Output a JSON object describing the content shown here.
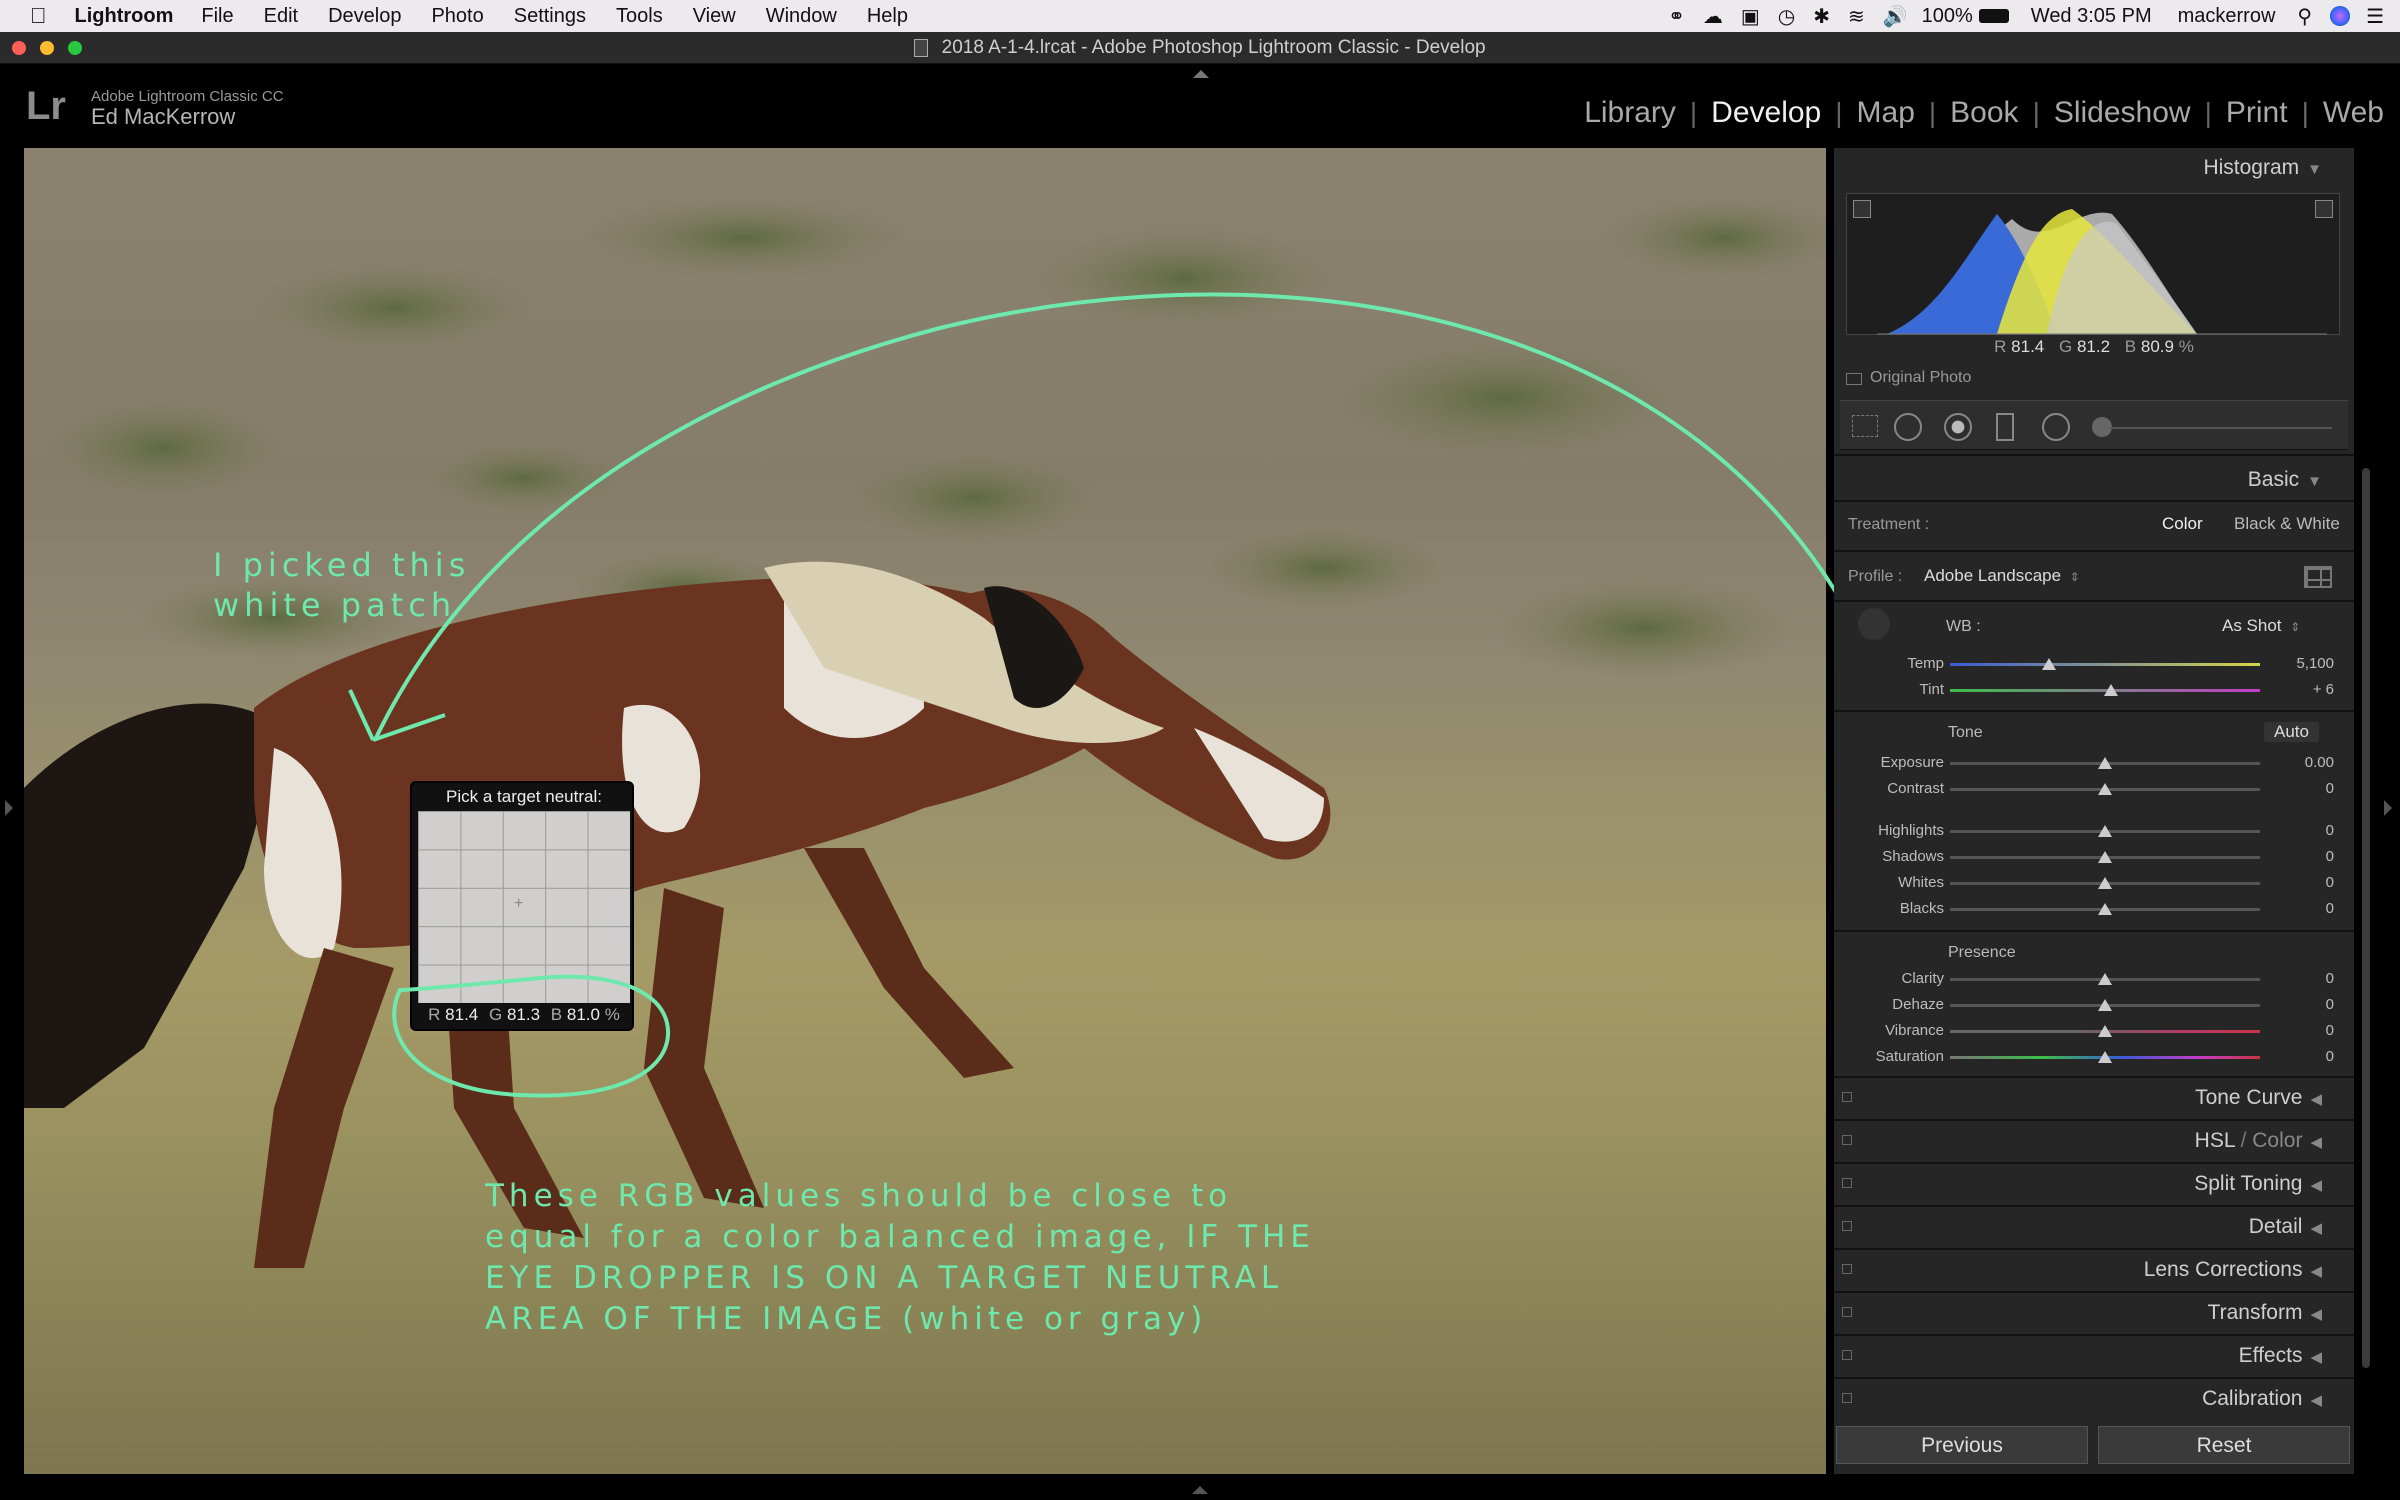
{
  "menubar": {
    "app_name": "Lightroom",
    "items": [
      "File",
      "Edit",
      "Develop",
      "Photo",
      "Settings",
      "Tools",
      "View",
      "Window",
      "Help"
    ],
    "battery": "100%",
    "clock": "Wed 3:05 PM",
    "user": "mackerrow"
  },
  "window": {
    "title": "2018 A-1-4.lrcat - Adobe Photoshop Lightroom Classic - Develop"
  },
  "identity": {
    "product": "Adobe Lightroom Classic CC",
    "owner": "Ed MacKerrow",
    "logo": "Lr"
  },
  "modules": {
    "items": [
      "Library",
      "Develop",
      "Map",
      "Book",
      "Slideshow",
      "Print",
      "Web"
    ],
    "active": "Develop"
  },
  "histogram": {
    "header": "Histogram",
    "r_label": "R",
    "r_value": "81.4",
    "g_label": "G",
    "g_value": "81.2",
    "b_label": "B",
    "b_value": "80.9",
    "unit": "%",
    "original_photo": "Original Photo"
  },
  "basic": {
    "header": "Basic",
    "treatment_label": "Treatment :",
    "treatment_color": "Color",
    "treatment_bw": "Black & White",
    "profile_label": "Profile :",
    "profile_value": "Adobe Landscape",
    "wb_label": "WB :",
    "wb_value": "As Shot",
    "temp_label": "Temp",
    "temp_value": "5,100",
    "temp_level": 0.32,
    "tint_label": "Tint",
    "tint_value": "+ 6",
    "tint_level": 0.52,
    "tone_label": "Tone",
    "auto_label": "Auto",
    "exposure_label": "Exposure",
    "exposure_value": "0.00",
    "contrast_label": "Contrast",
    "contrast_value": "0",
    "highlights_label": "Highlights",
    "highlights_value": "0",
    "shadows_label": "Shadows",
    "shadows_value": "0",
    "whites_label": "Whites",
    "whites_value": "0",
    "blacks_label": "Blacks",
    "blacks_value": "0",
    "presence_label": "Presence",
    "clarity_label": "Clarity",
    "clarity_value": "0",
    "dehaze_label": "Dehaze",
    "dehaze_value": "0",
    "vibrance_label": "Vibrance",
    "vibrance_value": "0",
    "saturation_label": "Saturation",
    "saturation_value": "0"
  },
  "panels": {
    "tone_curve": "Tone Curve",
    "hsl_a": "HSL",
    "hsl_sep": " / ",
    "hsl_b": "Color",
    "split_toning": "Split Toning",
    "detail": "Detail",
    "lens_corrections": "Lens Corrections",
    "transform": "Transform",
    "effects": "Effects",
    "calibration": "Calibration"
  },
  "buttons": {
    "previous": "Previous",
    "reset": "Reset"
  },
  "loupe": {
    "title": "Pick a target neutral:",
    "r_label": "R",
    "r_value": "81.4",
    "g_label": "G",
    "g_value": "81.3",
    "b_label": "B",
    "b_value": "81.0",
    "unit": "%"
  },
  "annotations": {
    "patch_line1": "I picked this",
    "patch_line2": "white patch",
    "note_line1": "These RGB values should be close to",
    "note_line2": "equal for a color balanced image, IF THE",
    "note_line3": "EYE DROPPER IS ON A TARGET NEUTRAL",
    "note_line4": "AREA OF THE IMAGE (white or gray)"
  },
  "colors": {
    "annotation": "#6ee8ac",
    "panel_bg": "#262626",
    "active_module": "#f0f0f0"
  }
}
